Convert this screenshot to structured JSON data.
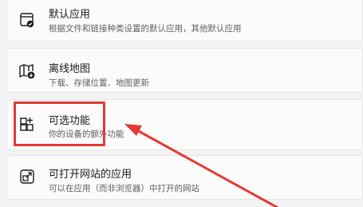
{
  "settings": {
    "items": [
      {
        "icon": "default-apps-icon",
        "title": "默认应用",
        "subtitle": "根据文件和链接种类设置的默认应用，其他默认应用"
      },
      {
        "icon": "offline-maps-icon",
        "title": "离线地图",
        "subtitle": "下载、存储位置、地图更新"
      },
      {
        "icon": "optional-features-icon",
        "title": "可选功能",
        "subtitle": "你的设备的额外功能"
      },
      {
        "icon": "apps-for-websites-icon",
        "title": "可打开网站的应用",
        "subtitle": "可以在应用（而非浏览器）中打开的网站"
      }
    ]
  },
  "annotation": {
    "highlight_color": "#e53935"
  }
}
